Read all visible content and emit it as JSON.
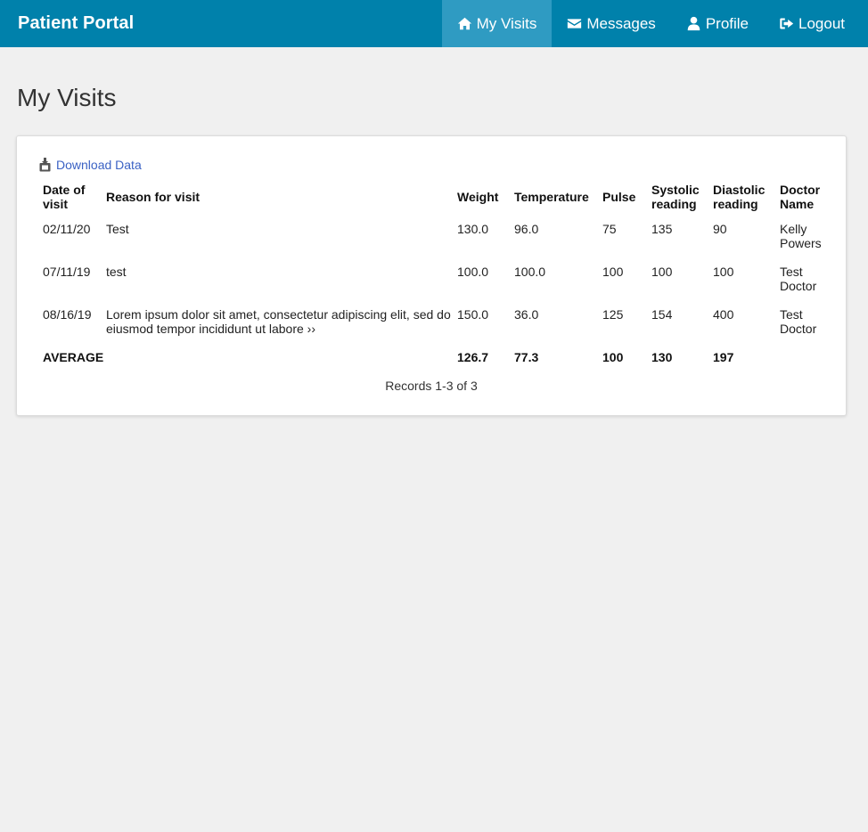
{
  "app": {
    "brand": "Patient Portal"
  },
  "nav": {
    "items": [
      {
        "label": "My Visits",
        "icon": "home-icon",
        "active": true
      },
      {
        "label": "Messages",
        "icon": "envelope-icon",
        "active": false
      },
      {
        "label": "Profile",
        "icon": "user-icon",
        "active": false
      },
      {
        "label": "Logout",
        "icon": "sign-out-icon",
        "active": false
      }
    ]
  },
  "page": {
    "title": "My Visits"
  },
  "download": {
    "label": "Download Data",
    "icon": "download-icon"
  },
  "table": {
    "headers": {
      "date": "Date of visit",
      "reason": "Reason for visit",
      "weight": "Weight",
      "temperature": "Temperature",
      "pulse": "Pulse",
      "systolic": "Systolic reading",
      "diastolic": "Diastolic reading",
      "doctor": "Doctor Name"
    },
    "rows": [
      {
        "date": "02/11/20",
        "reason": "Test",
        "weight": "130.0",
        "temperature": "96.0",
        "pulse": "75",
        "systolic": "135",
        "diastolic": "90",
        "doctor": "Kelly Powers"
      },
      {
        "date": "07/11/19",
        "reason": "test",
        "weight": "100.0",
        "temperature": "100.0",
        "pulse": "100",
        "systolic": "100",
        "diastolic": "100",
        "doctor": "Test Doctor"
      },
      {
        "date": "08/16/19",
        "reason": "Lorem ipsum dolor sit amet, consectetur adipiscing elit, sed do eiusmod tempor incididunt ut labore ››",
        "weight": "150.0",
        "temperature": "36.0",
        "pulse": "125",
        "systolic": "154",
        "diastolic": "400",
        "doctor": "Test Doctor"
      }
    ],
    "average": {
      "label": "AVERAGE",
      "weight": "126.7",
      "temperature": "77.3",
      "pulse": "100",
      "systolic": "130",
      "diastolic": "197"
    }
  },
  "pagination": {
    "records_text": "Records 1-3 of 3"
  },
  "colors": {
    "navbar": "#0081ab",
    "nav_active": "#2f9bc2",
    "link": "#3b62c4",
    "background": "#f0f0f0"
  }
}
